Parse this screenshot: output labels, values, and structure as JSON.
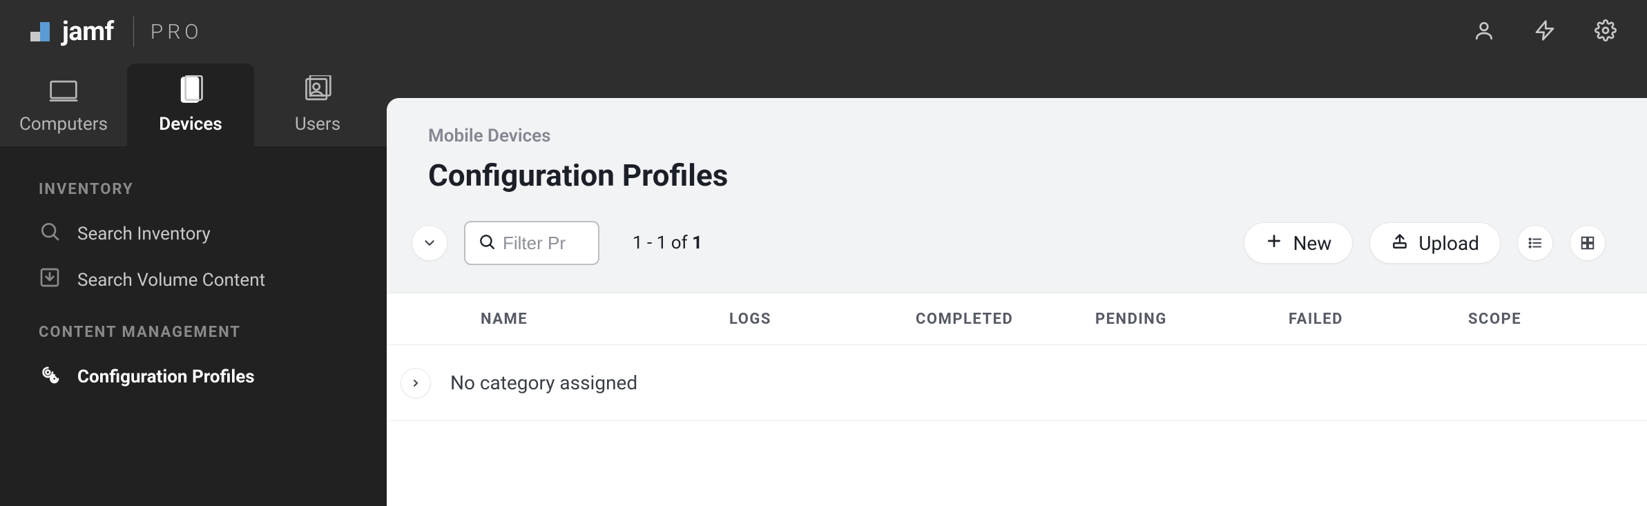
{
  "brand": {
    "name": "jamf",
    "suffix": "PRO"
  },
  "topbar_icons": {
    "user": "user-icon",
    "bolt": "bolt-icon",
    "gear": "gear-icon"
  },
  "tabs": [
    {
      "label": "Computers",
      "active": false
    },
    {
      "label": "Devices",
      "active": true
    },
    {
      "label": "Users",
      "active": false
    }
  ],
  "sidebar": {
    "sections": [
      {
        "title": "INVENTORY",
        "items": [
          {
            "label": "Search Inventory",
            "active": false,
            "icon": "search-icon"
          },
          {
            "label": "Search Volume Content",
            "active": false,
            "icon": "download-icon"
          }
        ]
      },
      {
        "title": "CONTENT MANAGEMENT",
        "items": [
          {
            "label": "Configuration Profiles",
            "active": true,
            "icon": "gear-icon"
          }
        ]
      }
    ]
  },
  "page": {
    "breadcrumb": "Mobile Devices",
    "title": "Configuration Profiles"
  },
  "toolbar": {
    "filter_placeholder": "Filter Pr",
    "count_prefix": "1 - 1 of ",
    "count_total": "1",
    "new_label": "New",
    "upload_label": "Upload"
  },
  "table": {
    "columns": [
      "NAME",
      "LOGS",
      "COMPLETED",
      "PENDING",
      "FAILED",
      "SCOPE"
    ],
    "groups": [
      {
        "label": "No category assigned"
      }
    ]
  }
}
